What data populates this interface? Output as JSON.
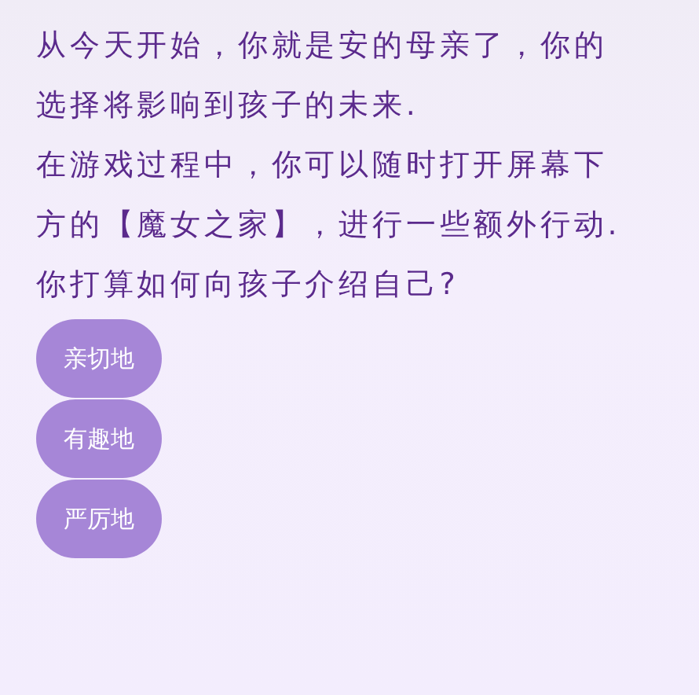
{
  "paragraphs": [
    "从今天开始，你就是安的母亲了，你的选择将影响到孩子的未来.",
    "在游戏过程中，你可以随时打开屏幕下方的【魔女之家】，进行一些额外行动.",
    "你打算如何向孩子介绍自己?"
  ],
  "choices": [
    {
      "label": "亲切地"
    },
    {
      "label": "有趣地"
    },
    {
      "label": "严厉地"
    }
  ]
}
